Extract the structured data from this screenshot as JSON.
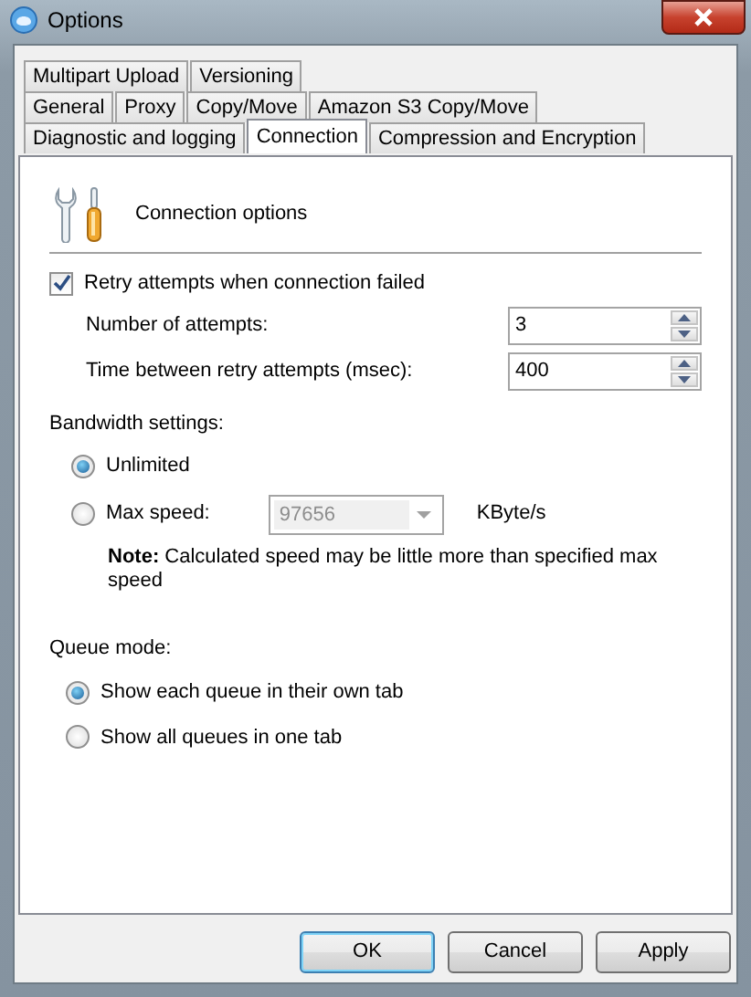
{
  "window": {
    "title": "Options"
  },
  "tab_rows": [
    {
      "tabs": [
        {
          "label": "Multipart Upload",
          "selected": false
        },
        {
          "label": "Versioning",
          "selected": false
        }
      ]
    },
    {
      "tabs": [
        {
          "label": "General",
          "selected": false
        },
        {
          "label": "Proxy",
          "selected": false
        },
        {
          "label": "Copy/Move",
          "selected": false
        },
        {
          "label": "Amazon S3 Copy/Move",
          "selected": false
        }
      ]
    },
    {
      "tabs": [
        {
          "label": "Diagnostic and logging",
          "selected": false
        },
        {
          "label": "Connection",
          "selected": true
        },
        {
          "label": "Compression and Encryption",
          "selected": false
        }
      ]
    }
  ],
  "header": {
    "title": "Connection options"
  },
  "retry": {
    "label": "Retry attempts when connection failed",
    "checked": true
  },
  "fields": [
    {
      "label": "Number of attempts:",
      "value": "3"
    },
    {
      "label": "Time between retry attempts (msec):",
      "value": "400"
    }
  ],
  "bandwidth": {
    "label": "Bandwidth settings:",
    "options": [
      {
        "label": "Unlimited",
        "selected": true
      },
      {
        "label": "Max speed:",
        "selected": false
      }
    ],
    "max_speed": {
      "value": "97656",
      "disabled": true,
      "unit": "KByte/s"
    },
    "note": "**Note:**  Calculated speed may be little more than specified max speed"
  },
  "queue_mode": {
    "label": "Queue mode:",
    "options": [
      {
        "label": "Show each queue in their own tab",
        "selected": true
      },
      {
        "label": "Show all queues in one tab",
        "selected": false
      }
    ]
  },
  "buttons": [
    {
      "label": "OK",
      "default": true
    },
    {
      "label": "Cancel",
      "default": false
    },
    {
      "label": "Apply",
      "default": false
    }
  ]
}
